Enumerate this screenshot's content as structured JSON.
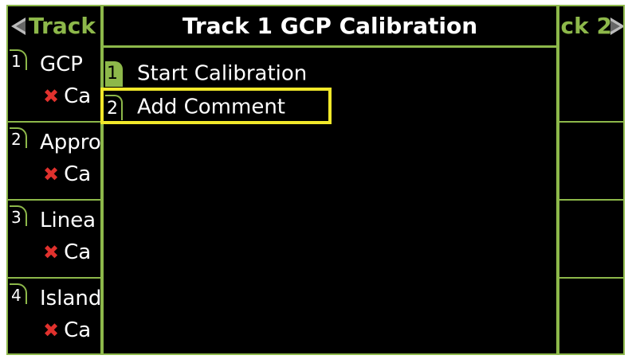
{
  "header": {
    "left_title": "Track",
    "right_title": "ck 2"
  },
  "left_list": [
    {
      "number": "1",
      "name": "GCP",
      "status": "Ca"
    },
    {
      "number": "2",
      "name": "Appro",
      "status": "Ca"
    },
    {
      "number": "3",
      "name": "Linea",
      "status": "Ca"
    },
    {
      "number": "4",
      "name": "Island",
      "status": "Ca"
    }
  ],
  "dialog": {
    "title": "Track 1 GCP Calibration",
    "items": [
      {
        "number": "1",
        "label": "Start Calibration"
      },
      {
        "number": "2",
        "label": "Add Comment"
      }
    ]
  },
  "colors": {
    "accent_green": "#8db84a",
    "selection_yellow": "#f1e82a",
    "fail_red": "#e0312d"
  },
  "icons": {
    "nav_left": "arrow-left-icon",
    "nav_right": "arrow-right-icon",
    "status": "x-mark-icon"
  }
}
